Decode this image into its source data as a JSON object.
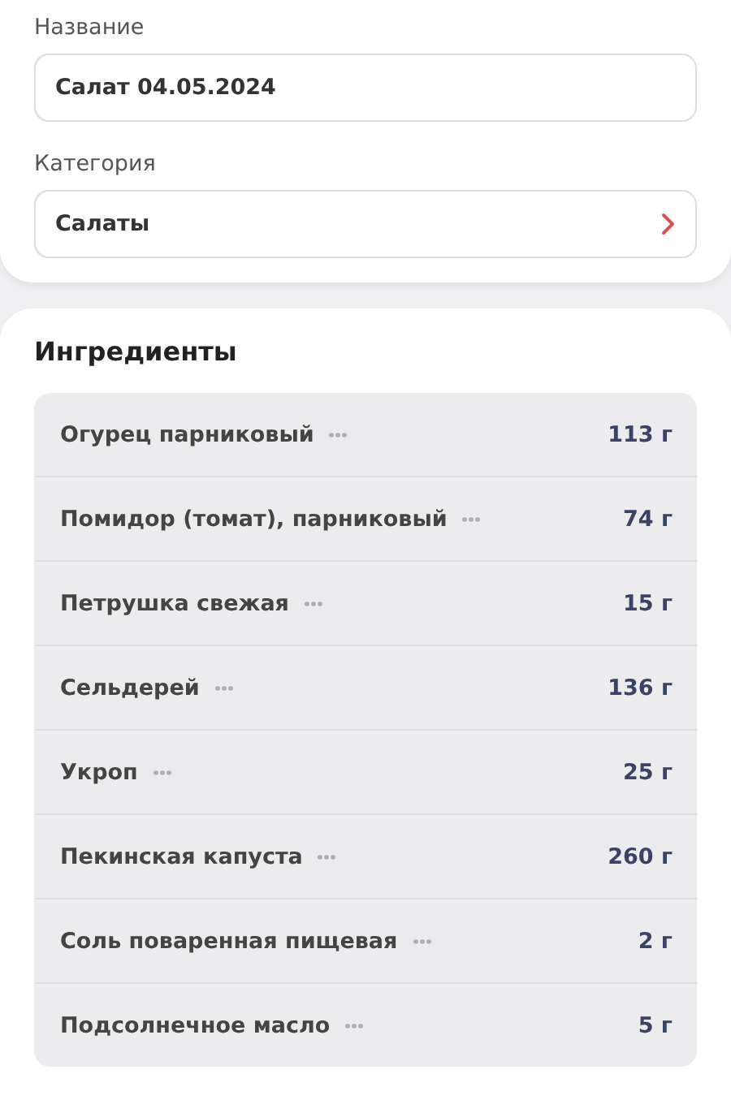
{
  "form": {
    "fields": [
      {
        "label": "Название",
        "value": "Салат 04.05.2024",
        "kind": "text"
      },
      {
        "label": "Категория",
        "value": "Салаты",
        "kind": "select"
      }
    ]
  },
  "ingredients": {
    "title": "Ингредиенты",
    "items": [
      {
        "name": "Огурец парниковый",
        "amount": "113 г"
      },
      {
        "name": "Помидор (томат), парниковый",
        "amount": "74 г"
      },
      {
        "name": "Петрушка свежая",
        "amount": "15 г"
      },
      {
        "name": "Сельдерей",
        "amount": "136 г"
      },
      {
        "name": "Укроп",
        "amount": "25 г"
      },
      {
        "name": "Пекинская капуста",
        "amount": "260 г"
      },
      {
        "name": "Соль поваренная пищевая",
        "amount": "2 г"
      },
      {
        "name": "Подсолнечное масло",
        "amount": "5 г"
      }
    ]
  }
}
